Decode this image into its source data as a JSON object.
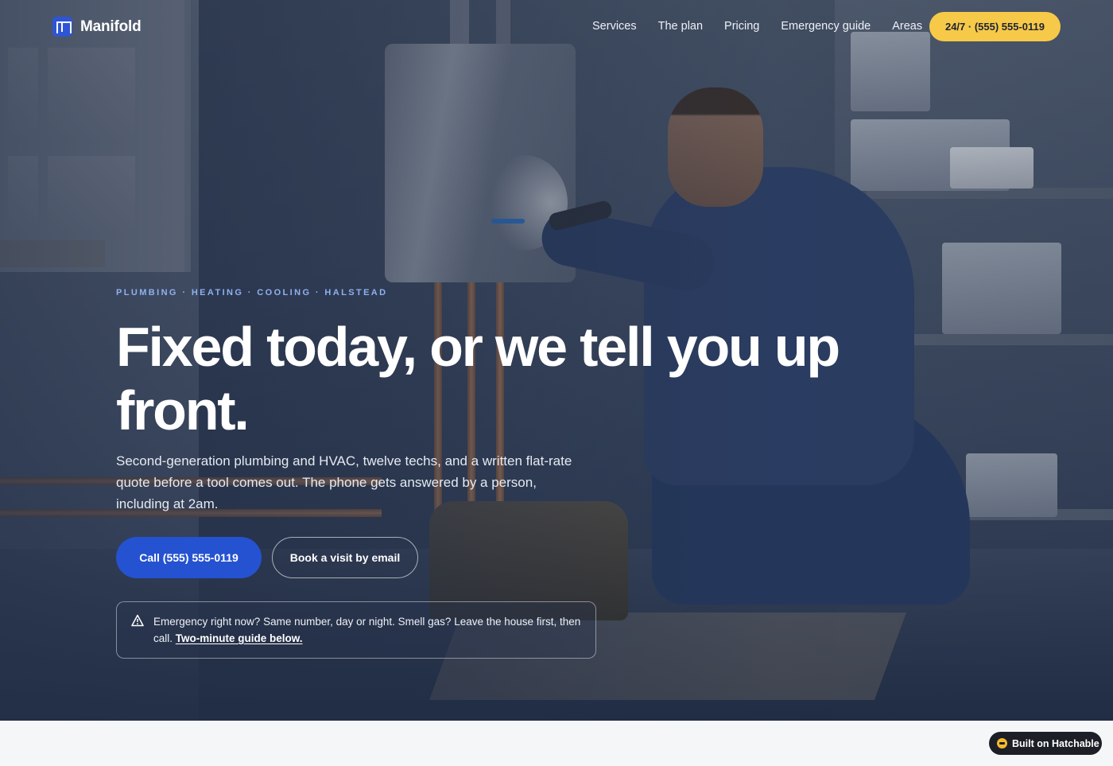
{
  "brand": {
    "name": "Manifold",
    "logo_icon": "manifold-logo-icon",
    "accent": "#2552d0"
  },
  "nav": {
    "items": [
      {
        "label": "Services"
      },
      {
        "label": "The plan"
      },
      {
        "label": "Pricing"
      },
      {
        "label": "Emergency guide"
      },
      {
        "label": "Areas"
      }
    ],
    "cta_label": "24/7 · (555) 555-0119",
    "cta_color": "#f7c948"
  },
  "hero": {
    "eyebrow": "PLUMBING · HEATING · COOLING · HALSTEAD",
    "headline": "Fixed today, or we tell you up front.",
    "subhead": "Second-generation plumbing and HVAC, twelve techs, and a written flat-rate quote before a tool comes out. The phone gets answered by a person, including at 2am.",
    "primary_cta": "Call (555) 555-0119",
    "secondary_cta": "Book a visit by email",
    "alert": {
      "icon": "warning-triangle-icon",
      "text": "Emergency right now? Same number, day or night. Smell gas? Leave the house first, then call.",
      "link": "Two-minute guide below."
    }
  },
  "badge": {
    "label": "Built on Hatchable",
    "icon": "hatchable-icon"
  }
}
